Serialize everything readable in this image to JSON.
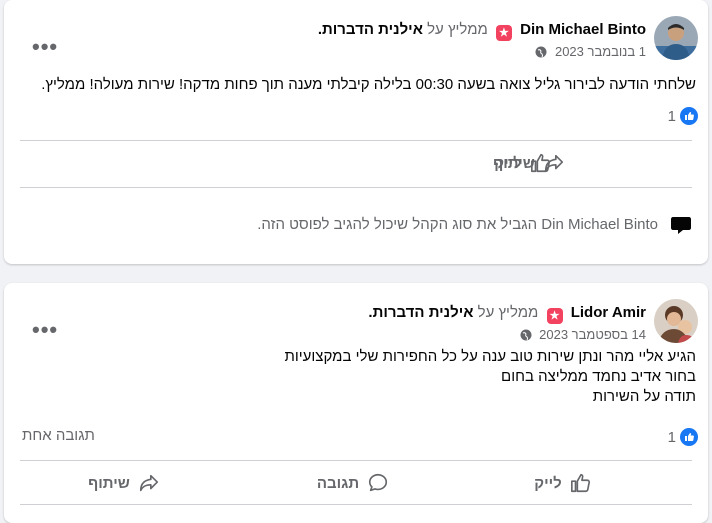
{
  "posts": [
    {
      "author": "Din Michael Binto",
      "recommends": "ממליץ על",
      "page": "אילנית הדברות",
      "date": "1 בנובמבר 2023",
      "text_lines": [
        "שלחתי הודעה לבירור גליל צואה בשעה 00:30 בלילה קיבלתי מענה תוך פחות מדקה! שירות מעולה! ממליץ."
      ],
      "likes": "1",
      "actions": {
        "like": "לייק",
        "share": "שיתוף"
      },
      "restriction": "Din Michael Binto הגביל את סוג הקהל שיכול להגיב לפוסט הזה."
    },
    {
      "author": "Lidor Amir",
      "recommends": "ממליץ על",
      "page": "אילנית הדברות",
      "date": "14 בספטמבר 2023",
      "text_lines": [
        "הגיע אליי מהר ונתן שירות טוב ענה על כל החפירות שלי במקצועיות",
        "בחור  אדיב נחמד ממליצה בחום",
        "תודה על השירות"
      ],
      "likes": "1",
      "comments": "תגובה אחת",
      "actions": {
        "like": "לייק",
        "comment": "תגובה",
        "share": "שיתוף"
      }
    }
  ],
  "icons": {
    "more": "more-options-icon",
    "globe": "globe-icon",
    "like": "thumbs-up-icon",
    "comment": "comment-bubble-icon",
    "share": "share-arrow-icon",
    "restricted": "speech-bubble-icon"
  },
  "colors": {
    "brand_blue": "#1877f2",
    "recommend_badge": "#f3425f",
    "muted": "#65676b"
  }
}
